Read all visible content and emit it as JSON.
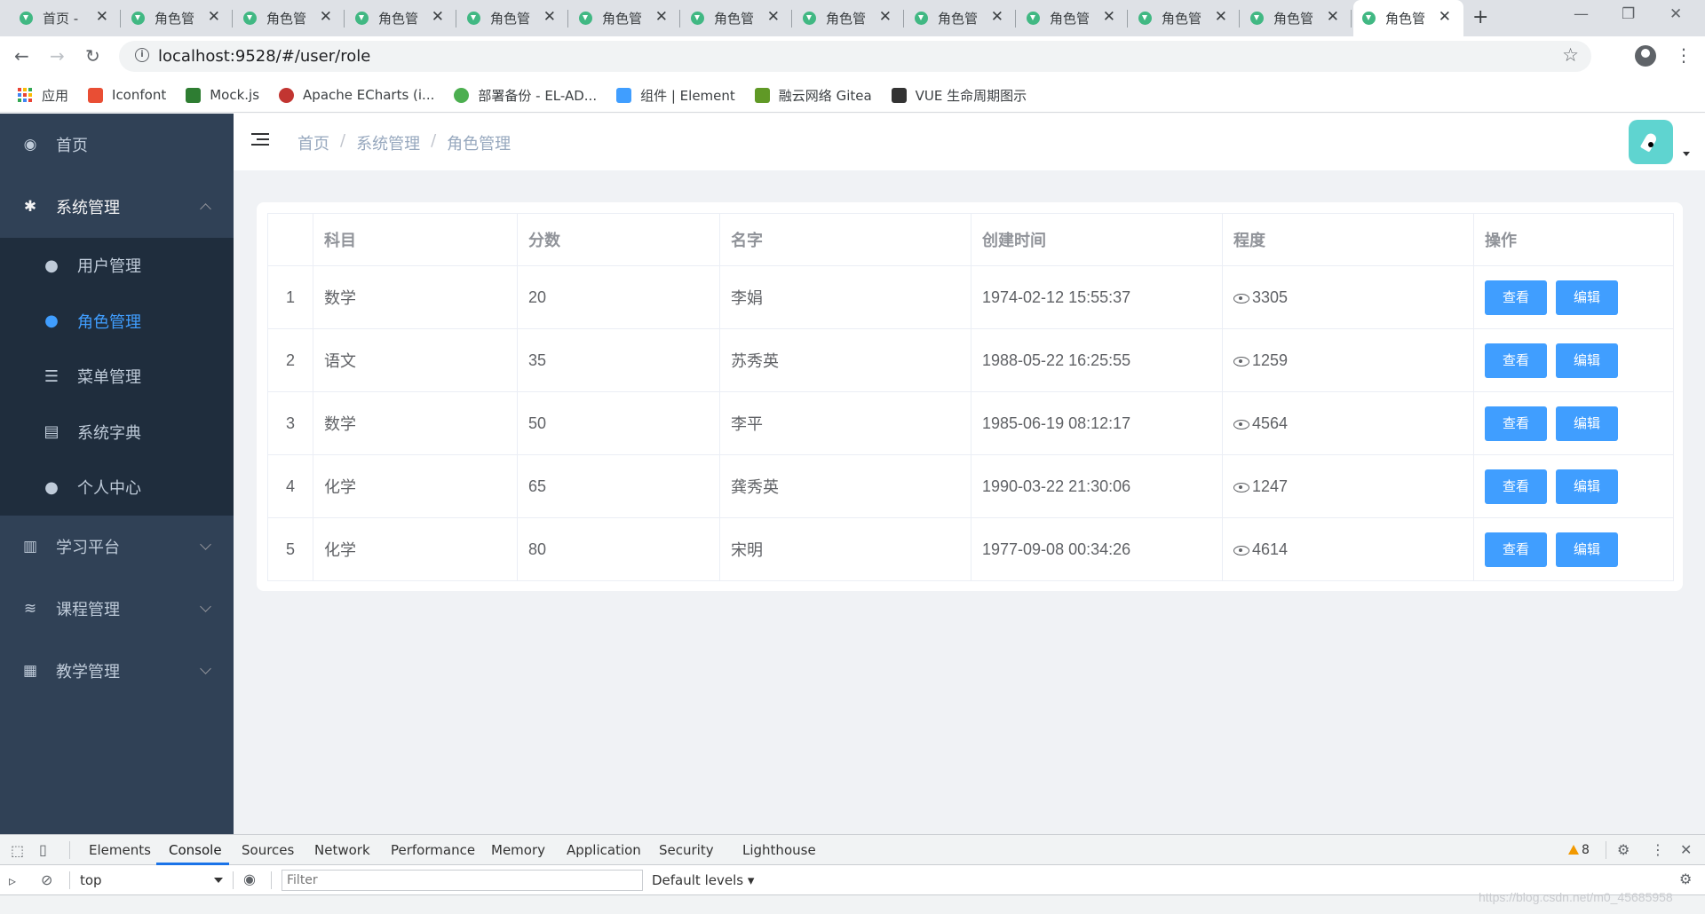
{
  "browser": {
    "tabs": [
      {
        "title": "首页 -",
        "active": false
      },
      {
        "title": "角色管",
        "active": false
      },
      {
        "title": "角色管",
        "active": false
      },
      {
        "title": "角色管",
        "active": false
      },
      {
        "title": "角色管",
        "active": false
      },
      {
        "title": "角色管",
        "active": false
      },
      {
        "title": "角色管",
        "active": false
      },
      {
        "title": "角色管",
        "active": false
      },
      {
        "title": "角色管",
        "active": false
      },
      {
        "title": "角色管",
        "active": false
      },
      {
        "title": "角色管",
        "active": false
      },
      {
        "title": "角色管",
        "active": false
      },
      {
        "title": "角色管",
        "active": true
      }
    ],
    "url": "localhost:9528/#/user/role",
    "bookmarks": [
      {
        "label": "应用",
        "icon": "apps-grid-icon",
        "color": "#ea4335"
      },
      {
        "label": "Iconfont",
        "icon": "iconfont-icon",
        "color": "#e94e34"
      },
      {
        "label": "Mock.js",
        "icon": "mockjs-icon",
        "color": "#2e7d32"
      },
      {
        "label": "Apache ECharts (i...",
        "icon": "echarts-icon",
        "color": "#c23531"
      },
      {
        "label": "部署备份 - EL-AD...",
        "icon": "deploy-icon",
        "color": "#4caf50"
      },
      {
        "label": "组件 | Element",
        "icon": "element-icon",
        "color": "#409eff"
      },
      {
        "label": "融云网络 Gitea",
        "icon": "gitea-icon",
        "color": "#609926"
      },
      {
        "label": "VUE 生命周期图示",
        "icon": "vue-lifecycle-icon",
        "color": "#333333"
      }
    ]
  },
  "sidebar": {
    "items": [
      {
        "label": "首页",
        "icon": "dashboard-icon",
        "glyph": "◉"
      },
      {
        "label": "系统管理",
        "icon": "gear-icon",
        "glyph": "✱",
        "open": true,
        "children": [
          {
            "label": "用户管理",
            "icon": "user-icon",
            "glyph": "●",
            "active": false
          },
          {
            "label": "角色管理",
            "icon": "users-icon",
            "glyph": "●",
            "active": true
          },
          {
            "label": "菜单管理",
            "icon": "list-icon",
            "glyph": "☰",
            "active": false
          },
          {
            "label": "系统字典",
            "icon": "dictionary-icon",
            "glyph": "▤",
            "active": false
          },
          {
            "label": "个人中心",
            "icon": "person-icon",
            "glyph": "●",
            "active": false
          }
        ]
      },
      {
        "label": "学习平台",
        "icon": "book-icon",
        "glyph": "▥"
      },
      {
        "label": "课程管理",
        "icon": "layers-icon",
        "glyph": "≋"
      },
      {
        "label": "教学管理",
        "icon": "grid-icon",
        "glyph": "▦"
      }
    ]
  },
  "breadcrumb": [
    "首页",
    "系统管理",
    "角色管理"
  ],
  "table": {
    "columns": [
      "",
      "科目",
      "分数",
      "名字",
      "创建时间",
      "程度",
      "操作"
    ],
    "rows": [
      {
        "index": "1",
        "subject": "数学",
        "score": "20",
        "name": "李娟",
        "created": "1974-02-12 15:55:37",
        "views": "3305"
      },
      {
        "index": "2",
        "subject": "语文",
        "score": "35",
        "name": "苏秀英",
        "created": "1988-05-22 16:25:55",
        "views": "1259"
      },
      {
        "index": "3",
        "subject": "数学",
        "score": "50",
        "name": "李平",
        "created": "1985-06-19 08:12:17",
        "views": "4564"
      },
      {
        "index": "4",
        "subject": "化学",
        "score": "65",
        "name": "龚秀英",
        "created": "1990-03-22 21:30:06",
        "views": "1247"
      },
      {
        "index": "5",
        "subject": "化学",
        "score": "80",
        "name": "宋明",
        "created": "1977-09-08 00:34:26",
        "views": "4614"
      }
    ],
    "view_label": "查看",
    "edit_label": "编辑"
  },
  "devtools": {
    "tabs": [
      "Elements",
      "Console",
      "Sources",
      "Network",
      "Performance",
      "Memory",
      "Application",
      "Security",
      "Lighthouse"
    ],
    "active_tab": "Console",
    "warnings": "8",
    "context": "top",
    "filter_placeholder": "Filter",
    "levels": "Default levels ▾"
  },
  "watermark": "https://blog.csdn.net/m0_45685958",
  "colors": {
    "sidebar_bg": "#304156",
    "submenu_bg": "#1f2d3d",
    "accent": "#409eff"
  }
}
